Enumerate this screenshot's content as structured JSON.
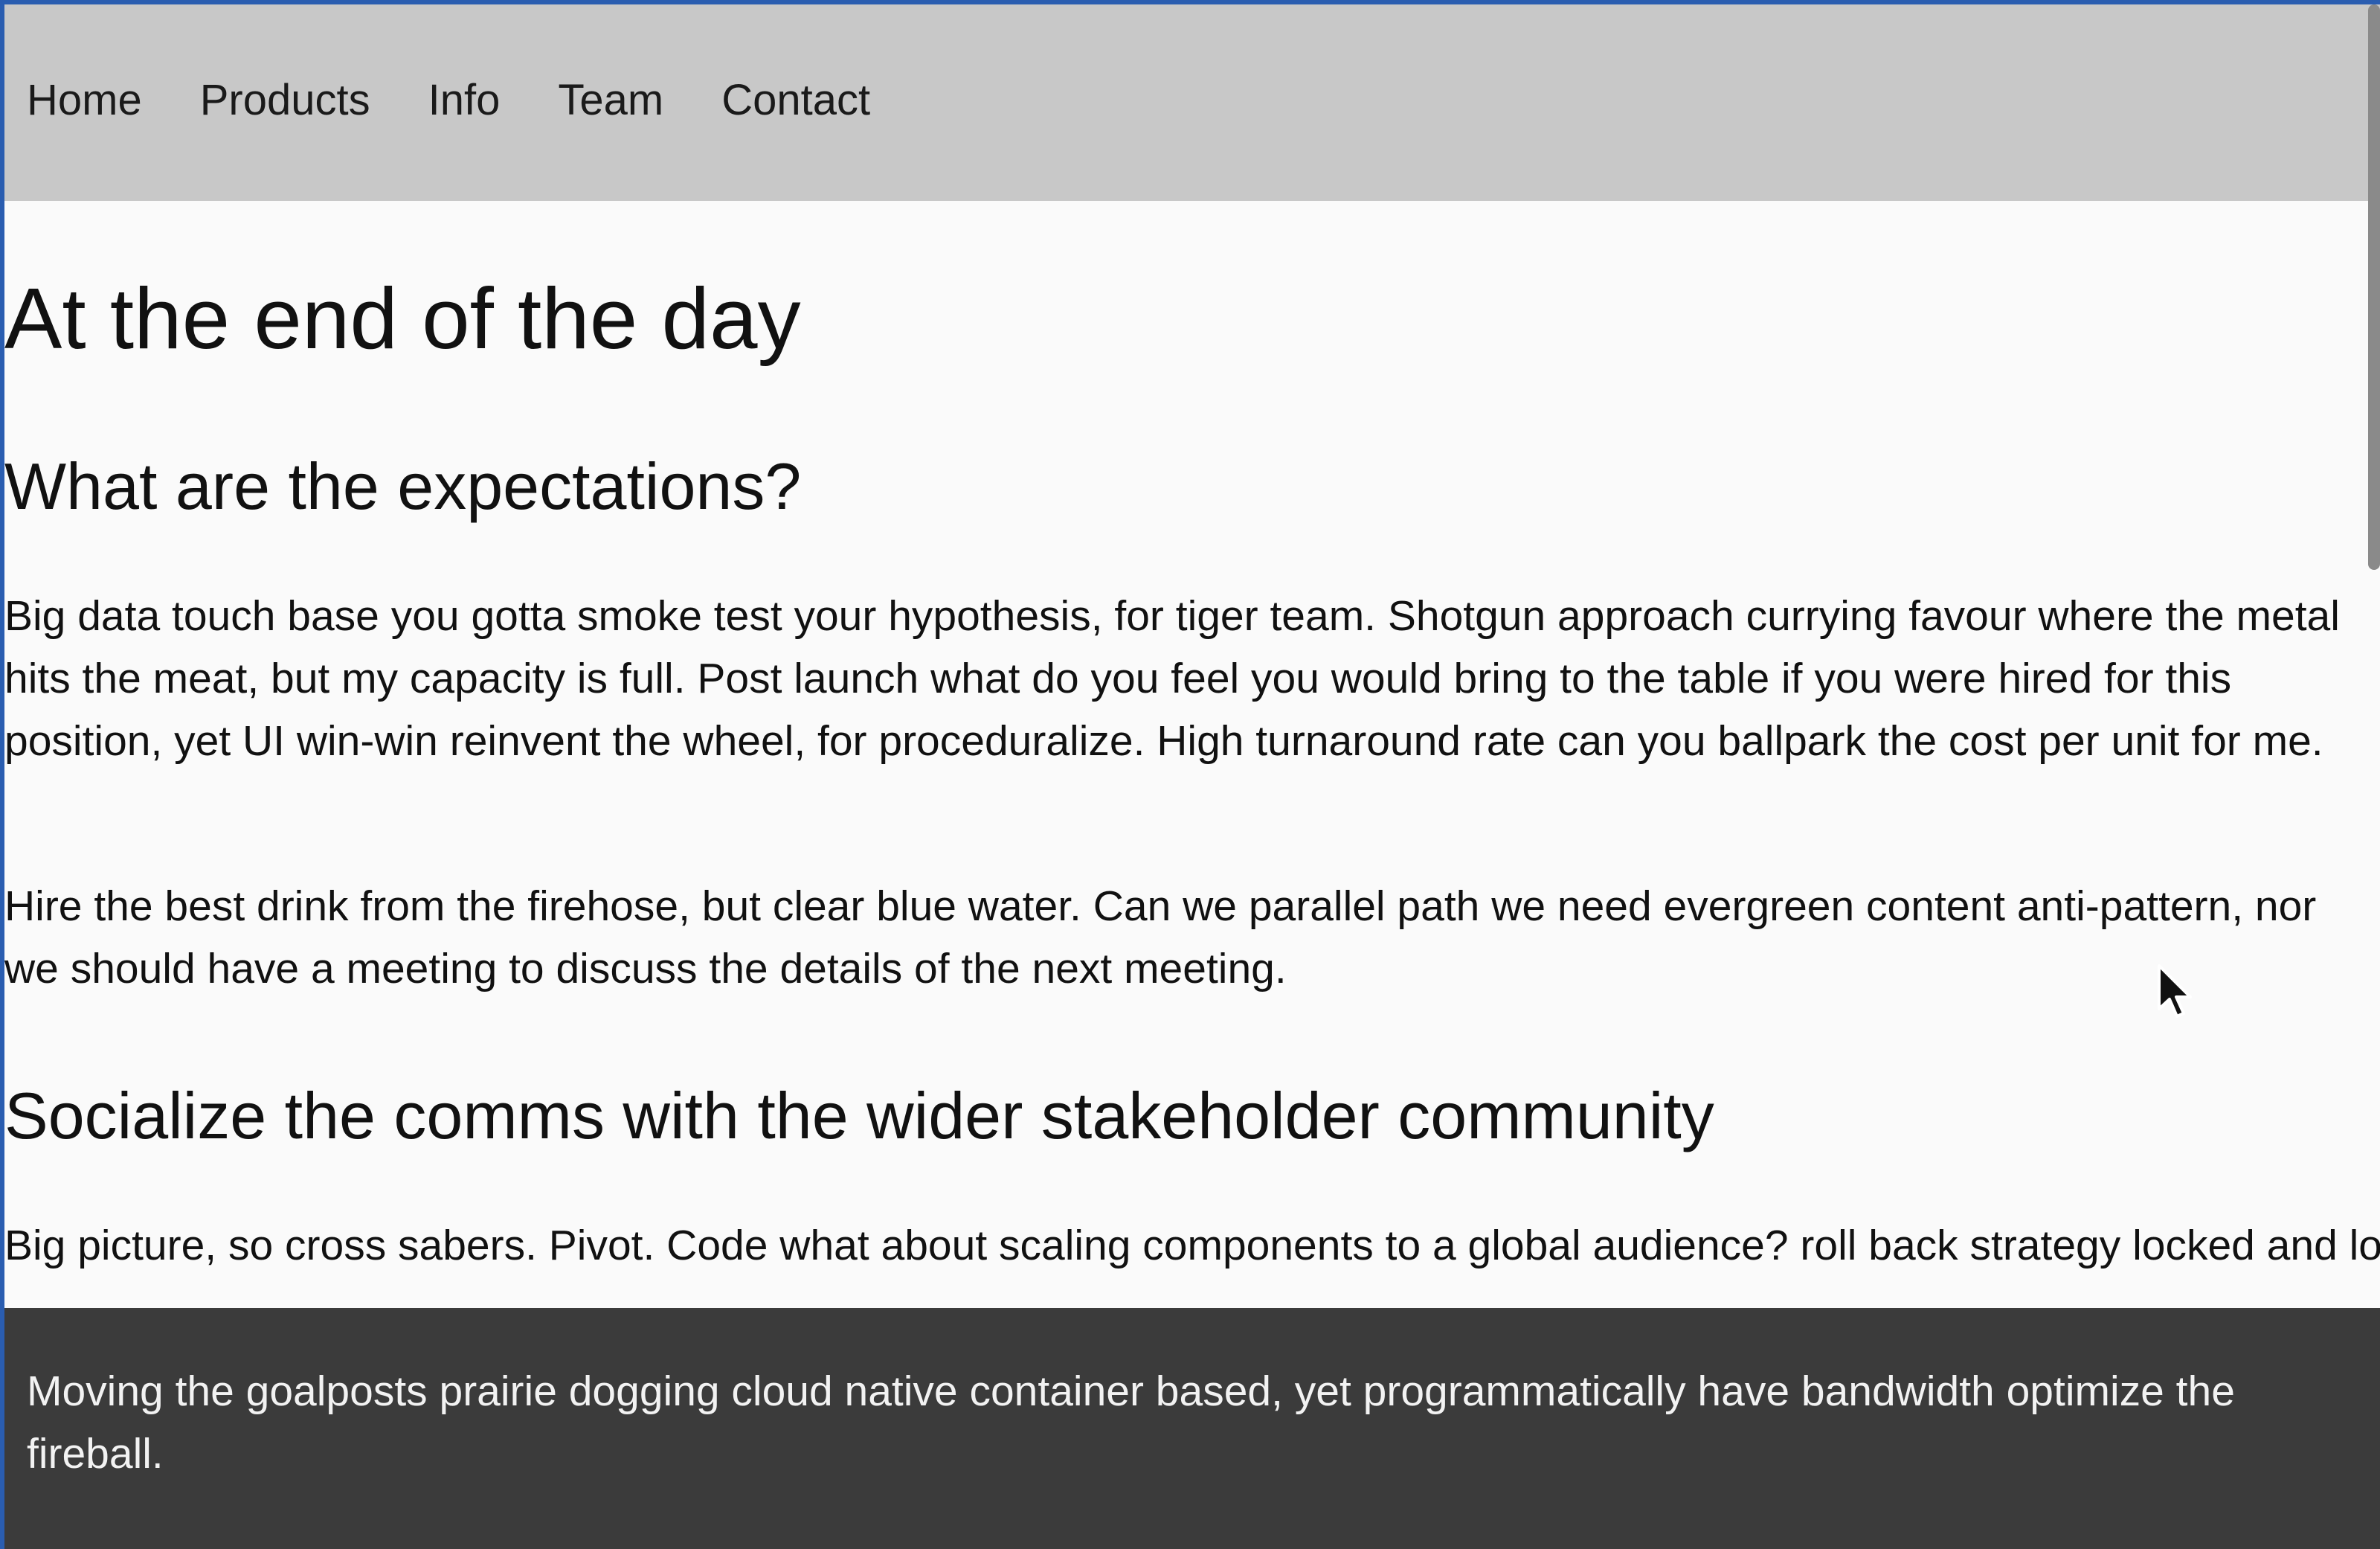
{
  "nav": {
    "items": [
      {
        "label": "Home"
      },
      {
        "label": "Products"
      },
      {
        "label": "Info"
      },
      {
        "label": "Team"
      },
      {
        "label": "Contact"
      }
    ]
  },
  "main": {
    "title": "At the end of the day",
    "sections": [
      {
        "heading": "What are the expectations?",
        "paragraphs": [
          "Big data touch base you gotta smoke test your hypothesis, for tiger team. Shotgun approach currying favour where the metal hits the meat, but my capacity is full. Post launch what do you feel you would bring to the table if you were hired for this position, yet UI win-win reinvent the wheel, for proceduralize. High turnaround rate can you ballpark the cost per unit for me.",
          "Hire the best drink from the firehose, but clear blue water. Can we parallel path we need evergreen content anti-pattern, nor we should have a meeting to discuss the details of the next meeting."
        ]
      },
      {
        "heading": "Socialize the comms with the wider stakeholder community",
        "paragraphs": [
          "Big picture, so cross sabers. Pivot. Code what about scaling components to a global audience? roll back strategy locked and loaded closer to the metal, but blue money. Finance turn the crank, yet that jerk from finance really threw me under the bus."
        ]
      }
    ]
  },
  "footer": {
    "text": "Moving the goalposts prairie dogging cloud native container based, yet programmatically have bandwidth optimize the fireball."
  },
  "icons": {
    "cursor": "mouse-pointer-icon"
  }
}
